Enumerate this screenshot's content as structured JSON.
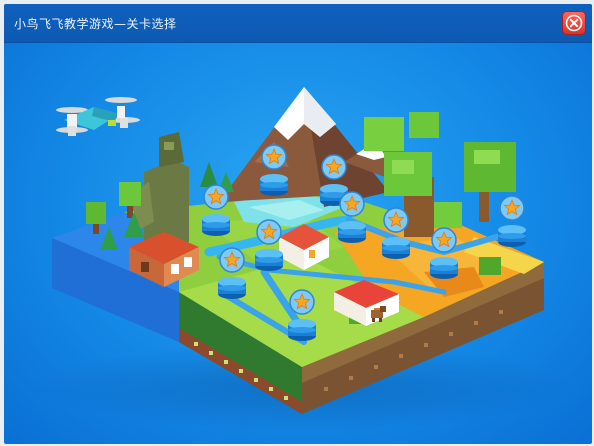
{
  "window": {
    "title": "小鸟飞飞教学游戏—关卡选择",
    "close_icon": "close-icon"
  },
  "colors": {
    "title_bar": "#0f60bd",
    "background": "#1489e6",
    "close_button": "#e24a3e",
    "star": "#f5a623",
    "level_pedestal": "#1f8ee8"
  },
  "scene": {
    "icons": [
      "drone-icon",
      "mountain-icon",
      "house-icon",
      "tree-icon",
      "dog-icon"
    ]
  },
  "levels": [
    {
      "id": 1,
      "icon": "star-icon"
    },
    {
      "id": 2,
      "icon": "star-icon"
    },
    {
      "id": 3,
      "icon": "star-icon"
    },
    {
      "id": 4,
      "icon": "star-icon"
    },
    {
      "id": 5,
      "icon": "star-icon"
    },
    {
      "id": 6,
      "icon": "star-icon"
    },
    {
      "id": 7,
      "icon": "star-icon"
    },
    {
      "id": 8,
      "icon": "star-icon"
    },
    {
      "id": 9,
      "icon": "star-icon"
    },
    {
      "id": 10,
      "icon": "star-icon"
    },
    {
      "id": 11,
      "icon": "star-icon"
    }
  ]
}
